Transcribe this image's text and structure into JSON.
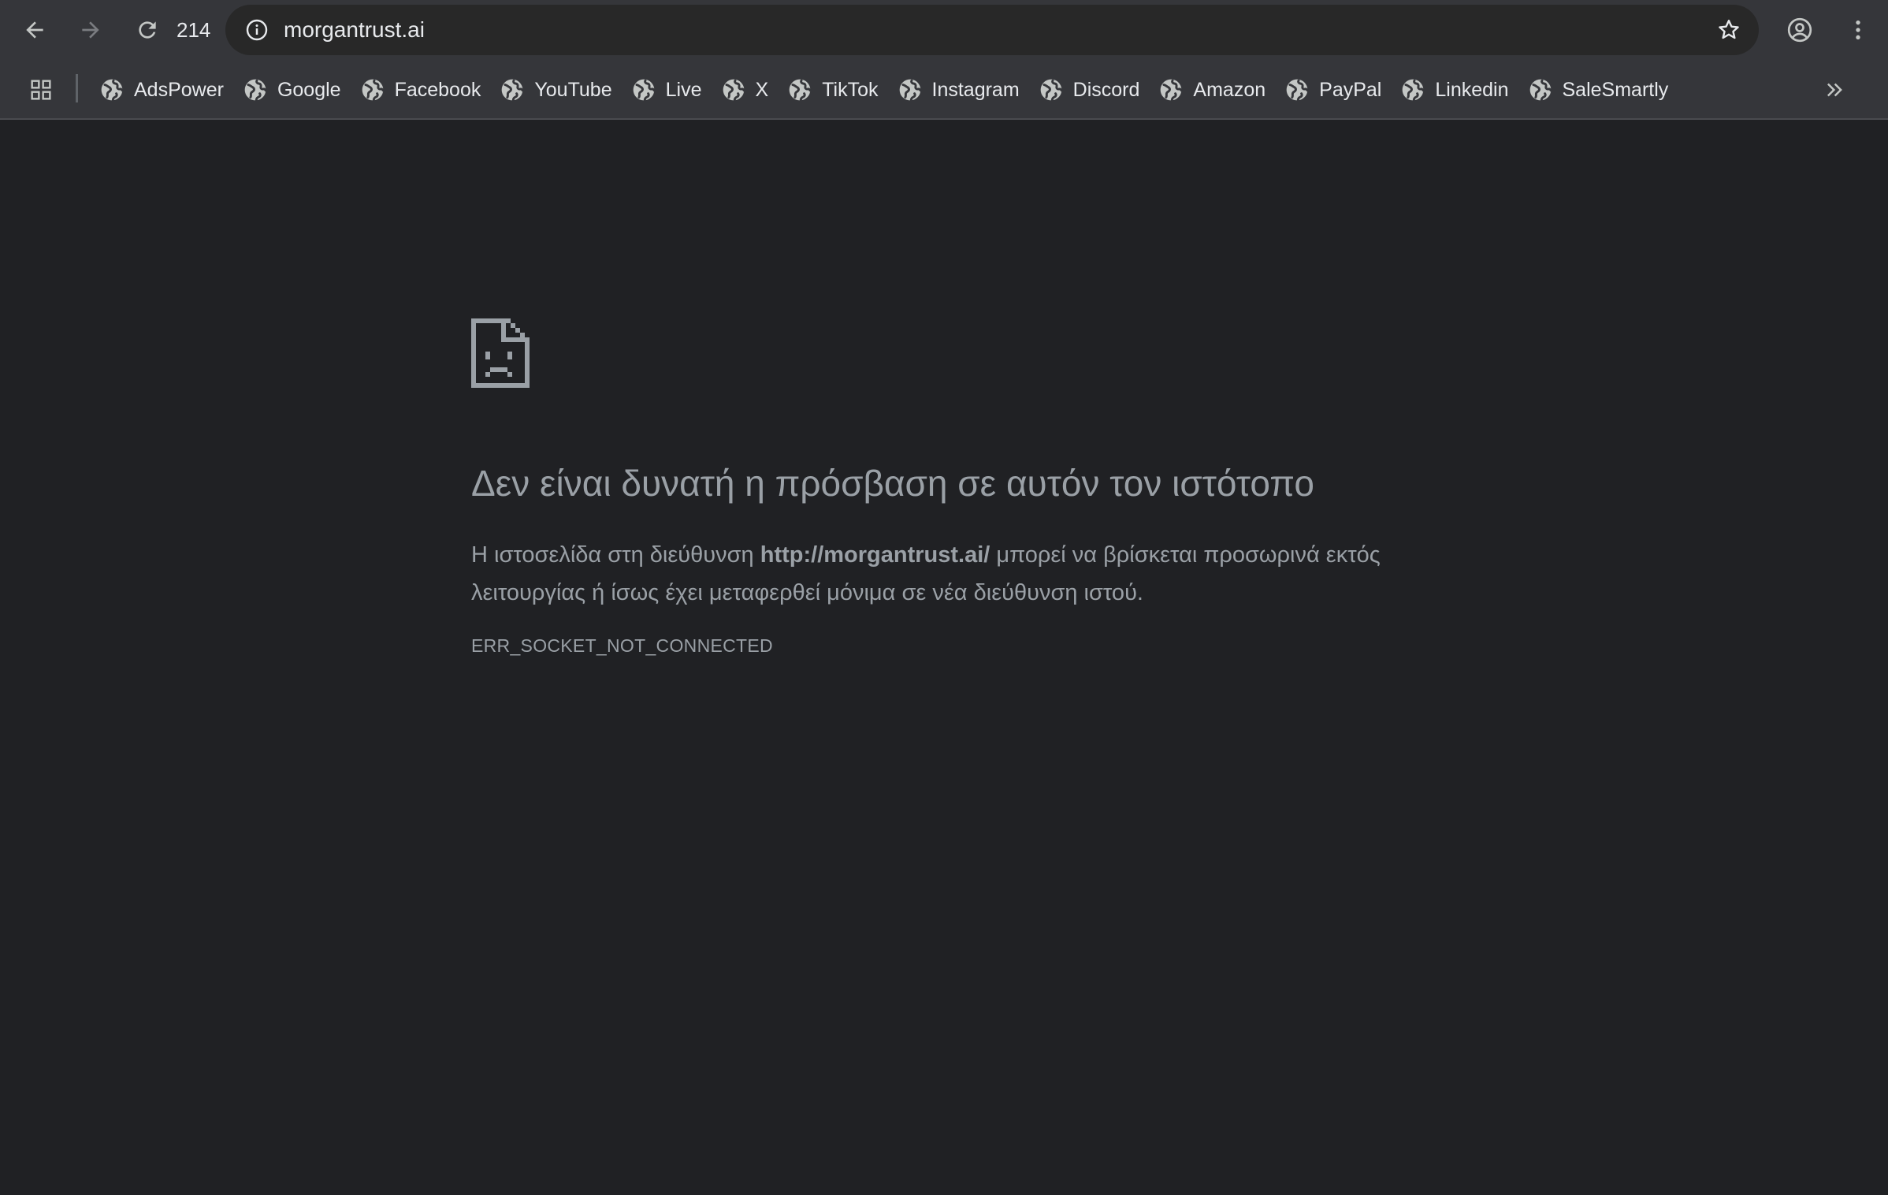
{
  "toolbar": {
    "tab_count": "214",
    "url": "morgantrust.ai",
    "back_icon": "arrow-back-icon",
    "forward_icon": "arrow-forward-icon",
    "reload_icon": "reload-icon",
    "site_info_icon": "info-icon",
    "bookmark_star_icon": "star-outline-icon",
    "profile_icon": "account-circle-icon",
    "menu_icon": "vertical-dots-icon"
  },
  "bookmarks": {
    "apps_icon": "grid-icon",
    "more_icon": "double-chevron-right-icon",
    "items": [
      {
        "label": "AdsPower",
        "icon": "globe-icon"
      },
      {
        "label": "Google",
        "icon": "globe-icon"
      },
      {
        "label": "Facebook",
        "icon": "globe-icon"
      },
      {
        "label": "YouTube",
        "icon": "globe-icon"
      },
      {
        "label": "Live",
        "icon": "globe-icon"
      },
      {
        "label": "X",
        "icon": "globe-icon"
      },
      {
        "label": "TikTok",
        "icon": "globe-icon"
      },
      {
        "label": "Instagram",
        "icon": "globe-icon"
      },
      {
        "label": "Discord",
        "icon": "globe-icon"
      },
      {
        "label": "Amazon",
        "icon": "globe-icon"
      },
      {
        "label": "PayPal",
        "icon": "globe-icon"
      },
      {
        "label": "Linkedin",
        "icon": "globe-icon"
      },
      {
        "label": "SaleSmartly",
        "icon": "globe-icon"
      }
    ]
  },
  "error_page": {
    "icon": "sad-document-icon",
    "title": "Δεν είναι δυνατή η πρόσβαση σε αυτόν τον ιστότοπο",
    "desc_before": "Η ιστοσελίδα στη διεύθυνση ",
    "desc_url": "http://morgantrust.ai/",
    "desc_after": " μπορεί να βρίσκεται προσωρινά εκτός λειτουργίας ή ίσως έχει μεταφερθεί μόνιμα σε νέα διεύθυνση ιστού.",
    "error_code": "ERR_SOCKET_NOT_CONNECTED"
  },
  "colors": {
    "chrome_bar": "#35363a",
    "omnibox": "#282828",
    "page_background": "#202124",
    "text_primary": "#e8eaed",
    "text_error": "#9aa0a6",
    "icon": "#c4c7c5"
  }
}
